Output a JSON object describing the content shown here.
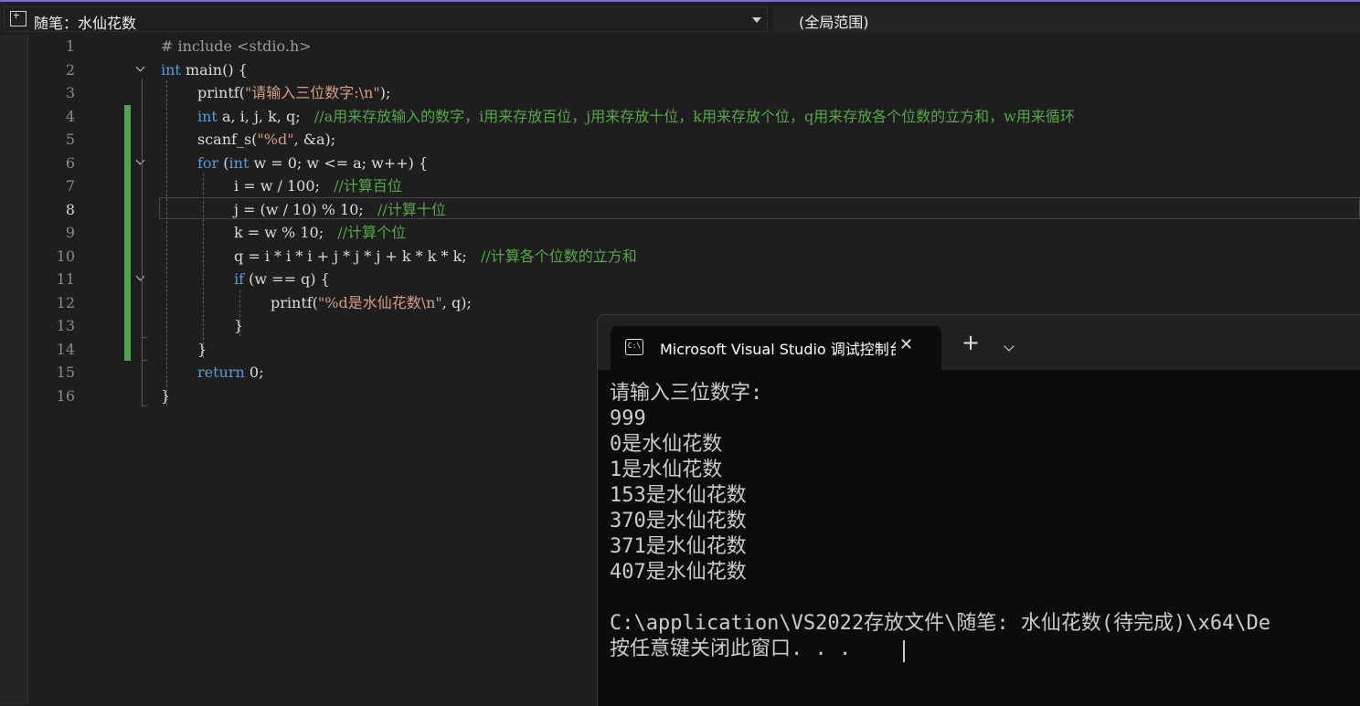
{
  "scope_bar": {
    "file_scope": "随笔：水仙花数",
    "global_scope": "(全局范围)"
  },
  "editor": {
    "line_numbers": [
      "1",
      "2",
      "3",
      "4",
      "5",
      "6",
      "7",
      "8",
      "9",
      "10",
      "11",
      "12",
      "13",
      "14",
      "15",
      "16"
    ],
    "current_line": 8,
    "code": {
      "l1": "# include <stdio.h>",
      "l2_kw": "int",
      "l2_rest": " main() {",
      "l3_a": "printf(",
      "l3_str": "\"请输入三位数字:\\n\"",
      "l3_b": ");",
      "l4_kw": "int",
      "l4_rest": " a, i, j, k, q;   ",
      "l4_cm": "//a用来存放输入的数字，i用来存放百位，j用来存放十位，k用来存放个位，q用来存放各个位数的立方和，w用来循环",
      "l5_a": "scanf_s(",
      "l5_str": "\"%d\"",
      "l5_b": ", &a);",
      "l6_kw1": "for",
      "l6_a": " (",
      "l6_kw2": "int",
      "l6_b": " w = 0; w <= a; w++) {",
      "l7_a": "i = w / 100;   ",
      "l7_cm": "//计算百位",
      "l8_a": "j = (w / 10) % 10;   ",
      "l8_cm": "//计算十位",
      "l9_a": "k = w % 10;   ",
      "l9_cm": "//计算个位",
      "l10_a": "q = i * i * i + j * j * j + k * k * k;   ",
      "l10_cm": "//计算各个位数的立方和",
      "l11_kw": "if",
      "l11_b": " (w == q) {",
      "l12_a": "printf(",
      "l12_str": "\"%d是水仙花数\\n\"",
      "l12_b": ", q);",
      "l13": "}",
      "l14": "}",
      "l15_kw": "return",
      "l15_b": " 0;",
      "l16": "}"
    }
  },
  "console": {
    "icon_text": "C:\\",
    "tab_title": "Microsoft Visual Studio 调试控制台",
    "close_symbol": "✕",
    "add_symbol": "+",
    "lines": [
      "请输入三位数字:",
      "999",
      "0是水仙花数",
      "1是水仙花数",
      "153是水仙花数",
      "370是水仙花数",
      "371是水仙花数",
      "407是水仙花数",
      "",
      "C:\\application\\VS2022存放文件\\随笔: 水仙花数(待完成)\\x64\\De",
      "按任意键关闭此窗口. . ."
    ]
  },
  "colors": {
    "accent": "#7f6bd0",
    "keyword": "#569cd6",
    "string": "#d69d85",
    "comment": "#57a64a",
    "change_bar": "#52a450"
  }
}
